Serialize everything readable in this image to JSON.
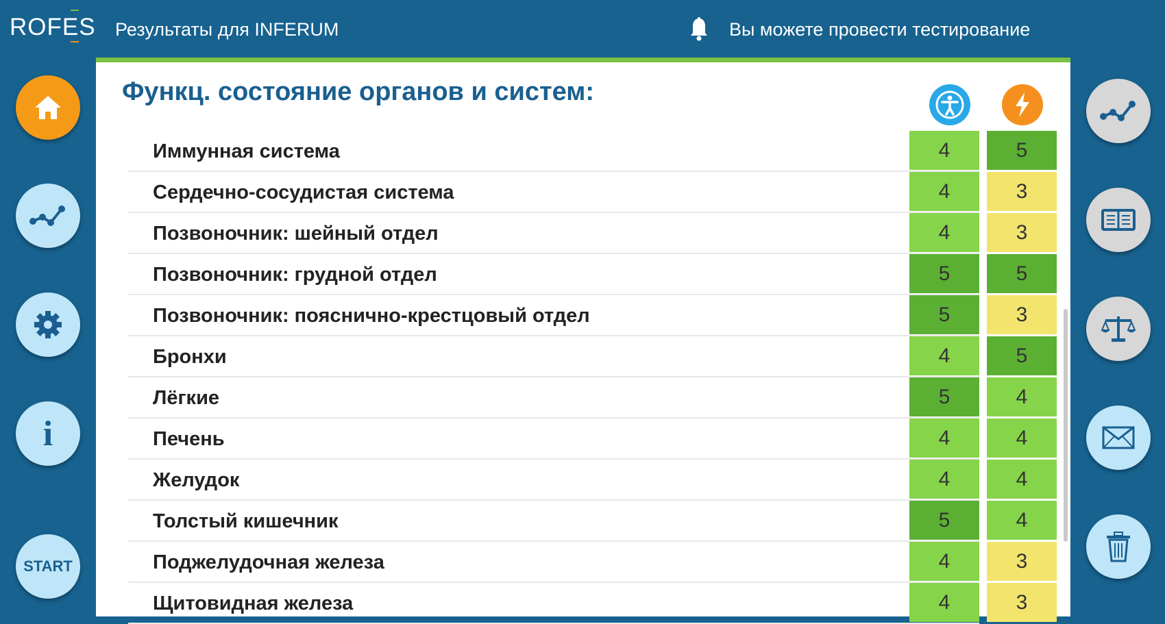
{
  "header": {
    "logo": "ROFES",
    "title": "Результаты для INFERUM",
    "notice": "Вы можете провести тестирование"
  },
  "panel": {
    "heading": "Функц. состояние органов и систем:",
    "columns": [
      "body-icon",
      "energy-icon"
    ],
    "rows": [
      {
        "name": "Иммунная система",
        "v1": "4",
        "v2": "5"
      },
      {
        "name": "Сердечно-сосудистая система",
        "v1": "4",
        "v2": "3"
      },
      {
        "name": "Позвоночник: шейный отдел",
        "v1": "4",
        "v2": "3"
      },
      {
        "name": "Позвоночник: грудной отдел",
        "v1": "5",
        "v2": "5"
      },
      {
        "name": "Позвоночник: пояснично-крестцовый отдел",
        "v1": "5",
        "v2": "3"
      },
      {
        "name": "Бронхи",
        "v1": "4",
        "v2": "5"
      },
      {
        "name": "Лёгкие",
        "v1": "5",
        "v2": "4"
      },
      {
        "name": "Печень",
        "v1": "4",
        "v2": "4"
      },
      {
        "name": "Желудок",
        "v1": "4",
        "v2": "4"
      },
      {
        "name": "Толстый кишечник",
        "v1": "5",
        "v2": "4"
      },
      {
        "name": "Поджелудочная железа",
        "v1": "4",
        "v2": "3"
      },
      {
        "name": "Щитовидная железа",
        "v1": "4",
        "v2": "3"
      }
    ]
  },
  "left_nav": {
    "items": [
      "home-icon",
      "chart-icon",
      "gear-icon",
      "info-icon",
      "start"
    ],
    "info_label": "i",
    "start_label": "START"
  },
  "right_nav": {
    "items": [
      "chart-icon",
      "book-icon",
      "scales-icon",
      "mail-icon",
      "trash-icon"
    ]
  },
  "colors": {
    "header_bg": "#17628f",
    "accent_green": "#7ac143",
    "score_3": "#f3e46d",
    "score_4": "#86d44a",
    "score_5": "#5bb033",
    "home_orange": "#f59a17"
  }
}
